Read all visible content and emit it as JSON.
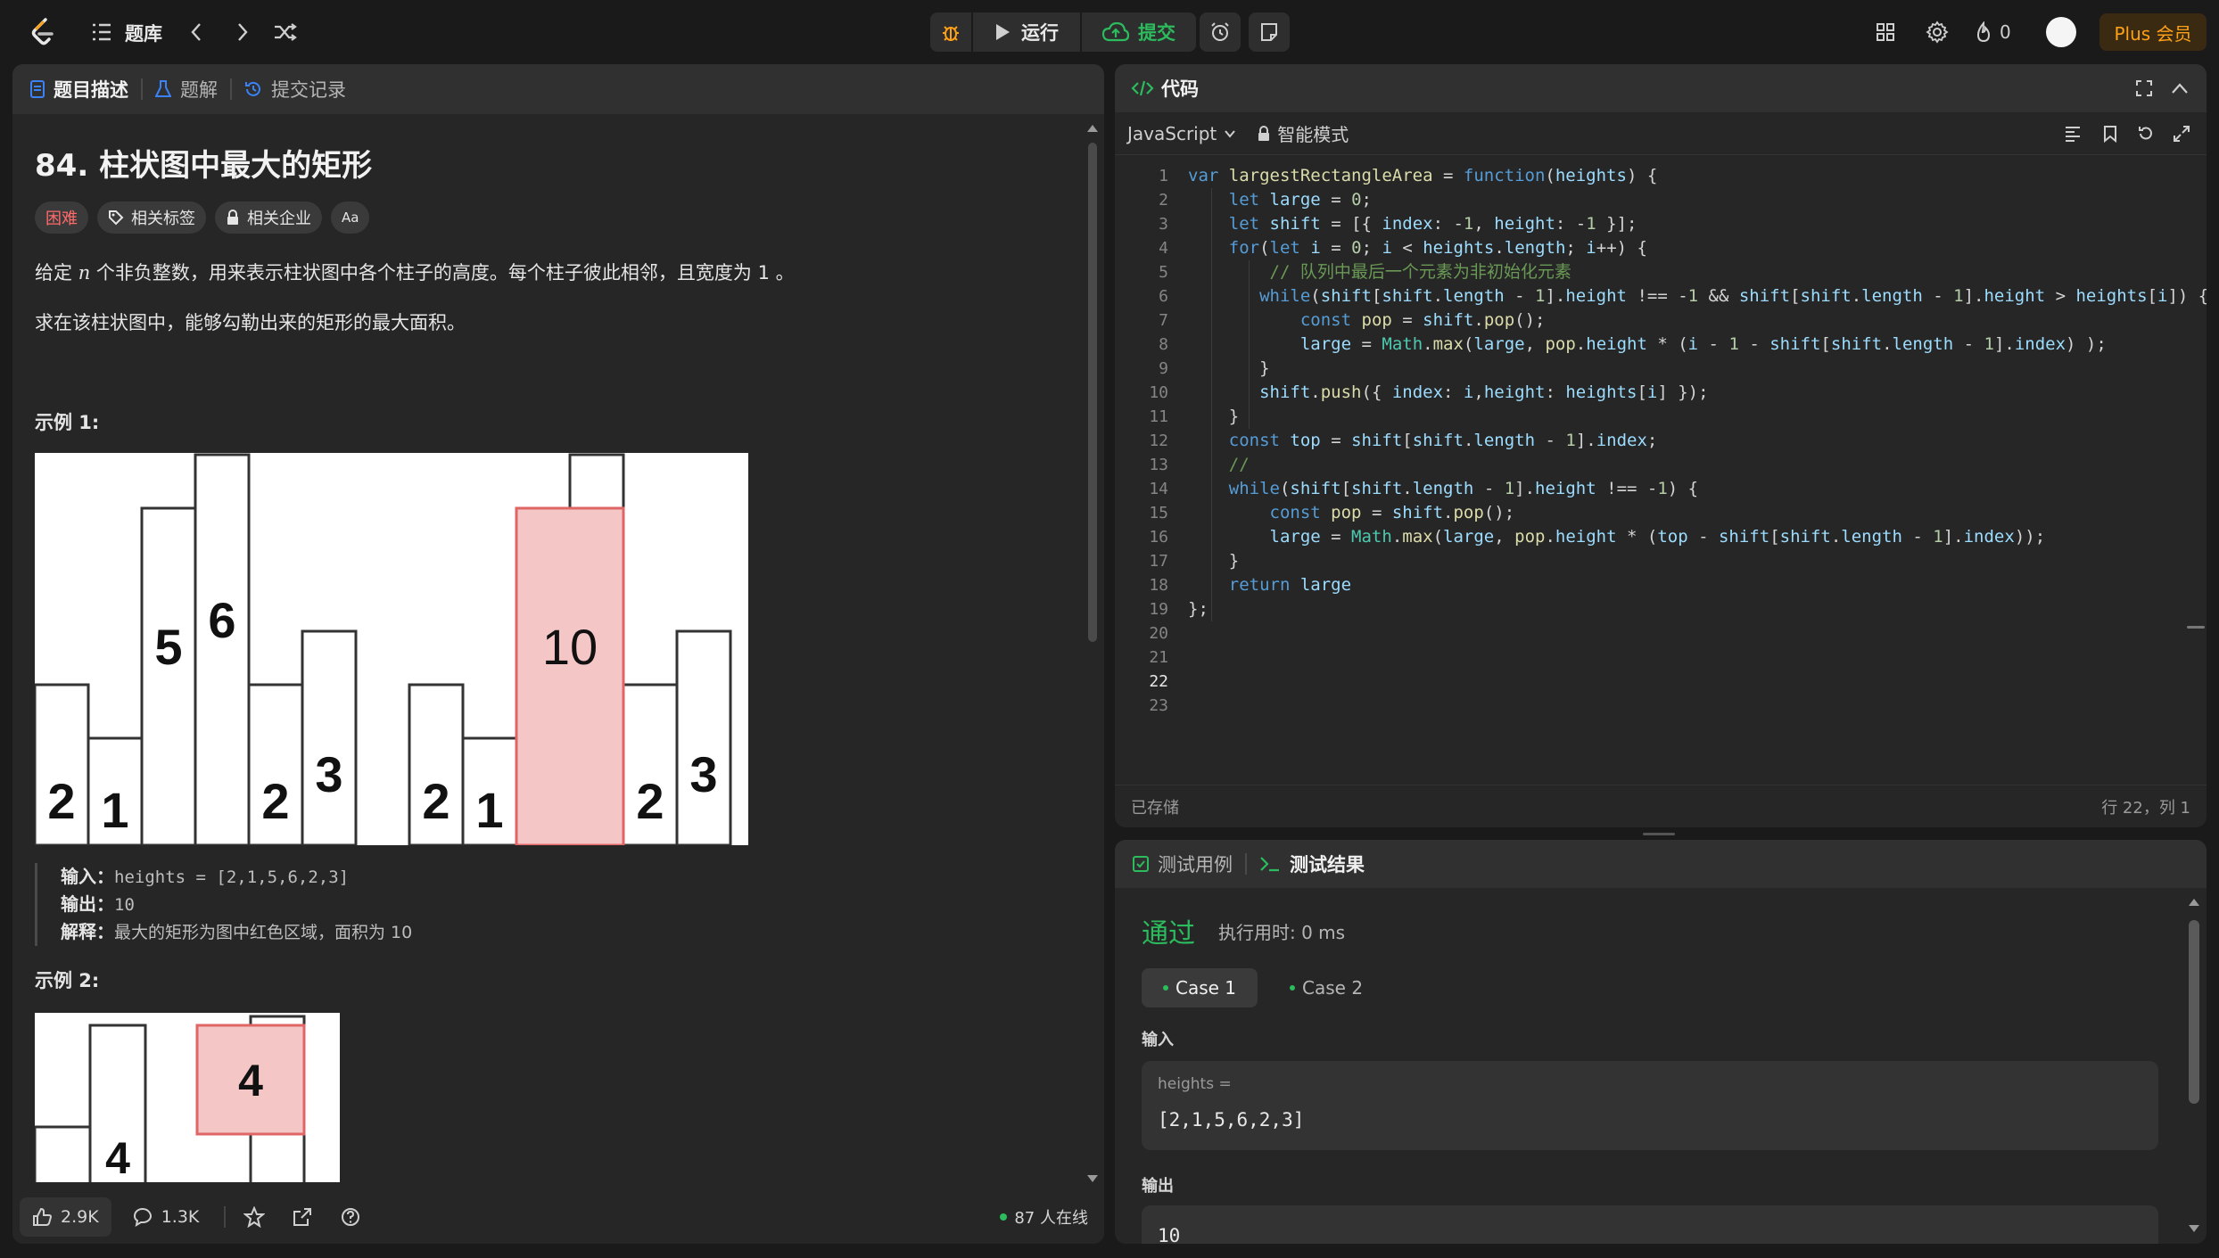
{
  "nav": {
    "problem_bank": "题库",
    "run": "运行",
    "submit": "提交",
    "streak": "0",
    "plus": "Plus 会员"
  },
  "left": {
    "tabs": [
      "题目描述",
      "题解",
      "提交记录"
    ],
    "title": "84. 柱状图中最大的矩形",
    "tags": [
      "困难",
      "相关标签",
      "相关企业",
      "Aa"
    ],
    "desc1_a": "给定",
    "desc1_n": "n",
    "desc1_b": "个非负整数，用来表示柱状图中各个柱子的高度。每个柱子彼此相邻，且宽度为 1 。",
    "desc2": "求在该柱状图中，能够勾勒出来的矩形的最大面积。",
    "ex1_title": "示例 1:",
    "ex1": {
      "input_label": "输入：",
      "input_value": "heights = [2,1,5,6,2,3]",
      "output_label": "输出：",
      "output_value": "10",
      "explain_label": "解释：",
      "explain_value": "最大的矩形为图中红色区域，面积为 10"
    },
    "ex2_title": "示例 2:",
    "fig1": {
      "left_bars": [
        "2",
        "1",
        "5",
        "6",
        "2",
        "3"
      ],
      "right_bars": [
        "2",
        "1",
        "10",
        "2",
        "3"
      ]
    },
    "fig2": {
      "labels": [
        "4",
        "4"
      ]
    },
    "footer": {
      "likes": "2.9K",
      "comments": "1.3K",
      "online": "87 人在线"
    }
  },
  "code": {
    "title": "代码",
    "language": "JavaScript",
    "mode": "智能模式",
    "saved": "已存储",
    "cursor": "行 22，列 1",
    "lines": [
      "var largestRectangleArea = function(heights) {",
      "    let large = 0;",
      "    let shift = [{ index: -1, height: -1 }];",
      "    for(let i = 0; i < heights.length; i++) {",
      "        // 队列中最后一个元素为非初始化元素",
      "       while(shift[shift.length - 1].height !== -1 && shift[shift.length - 1].height > heights[i]) {",
      "           const pop = shift.pop();",
      "           large = Math.max(large, pop.height * (i - 1 - shift[shift.length - 1].index) );",
      "       }",
      "       shift.push({ index: i,height: heights[i] });",
      "    }",
      "    const top = shift[shift.length - 1].index;",
      "    //",
      "    while(shift[shift.length - 1].height !== -1) {",
      "        const pop = shift.pop();",
      "        large = Math.max(large, pop.height * (top - shift[shift.length - 1].index));",
      "    }",
      "    return large",
      "};",
      "",
      "",
      "",
      ""
    ]
  },
  "result": {
    "tabs": [
      "测试用例",
      "测试结果"
    ],
    "status": "通过",
    "runtime": "执行用时: 0 ms",
    "cases": [
      "Case 1",
      "Case 2"
    ],
    "input_label": "输入",
    "var_name": "heights =",
    "var_value": "[2,1,5,6,2,3]",
    "output_label": "输出",
    "output_value": "10"
  },
  "colors": {
    "accent": "#ffa116",
    "pass": "#2cbb5d",
    "highlight": "#f5c6c6"
  }
}
